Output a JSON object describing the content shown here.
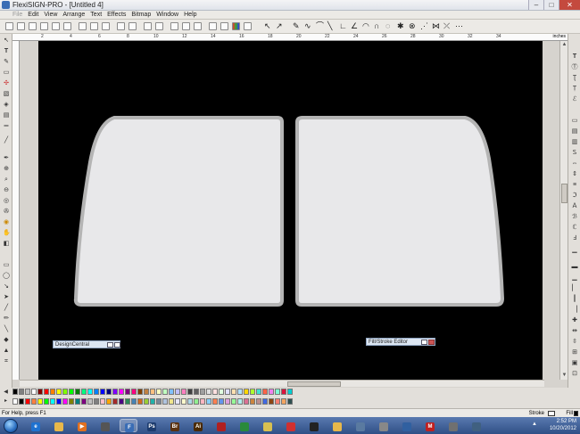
{
  "window": {
    "title": "FlexiSIGN-PRO - [Untitled 4]",
    "min": "–",
    "max": "□",
    "close": "✕"
  },
  "menu": [
    "File",
    "Edit",
    "View",
    "Arrange",
    "Text",
    "Effects",
    "Bitmap",
    "Window",
    "Help"
  ],
  "ruler": {
    "units": "inches",
    "labels": [
      "2",
      "4",
      "6",
      "8",
      "10",
      "12",
      "14",
      "16",
      "18",
      "20",
      "22",
      "24",
      "26",
      "28",
      "30",
      "32",
      "34"
    ]
  },
  "canvas": {
    "background": "#000000",
    "shape_fill": "#e8e8ea",
    "shape_stroke": "#b4b4b4"
  },
  "panels": {
    "design_central": "DesignCentral",
    "fill_stroke_editor": "Fill/Stroke Editor"
  },
  "palette_colors_row1": [
    "#000000",
    "#808080",
    "#c0c0c0",
    "#ffffff",
    "#800000",
    "#ff0000",
    "#ff8000",
    "#ffff00",
    "#80ff00",
    "#00ff00",
    "#008000",
    "#00ff80",
    "#00ffff",
    "#0080ff",
    "#0000ff",
    "#000080",
    "#8000ff",
    "#ff00ff",
    "#800080",
    "#ff0080",
    "#804000",
    "#c08040",
    "#ffc080",
    "#ffffc0",
    "#c0ffc0",
    "#80c0ff",
    "#c0c0ff",
    "#ff80c0",
    "#404040",
    "#606060",
    "#a0a0a0",
    "#e0e0e0",
    "#ffe0e0",
    "#e0ffe0",
    "#e0e0ff",
    "#ffe0b0",
    "#b0e0ff",
    "#ffd700",
    "#adff2f",
    "#40e0d0",
    "#ff6347",
    "#ee82ee",
    "#7fffd4",
    "#dc143c",
    "#00ced1"
  ],
  "palette_colors_row2": [
    "#ffffff",
    "#000000",
    "#ff0000",
    "#ff8040",
    "#ffff00",
    "#00ff00",
    "#00ffff",
    "#0000ff",
    "#ff00ff",
    "#808000",
    "#008080",
    "#800080",
    "#c0c0c0",
    "#808080",
    "#ffc0cb",
    "#ffa500",
    "#a52a2a",
    "#4b0082",
    "#2e8b57",
    "#4682b4",
    "#d2691e",
    "#9acd32",
    "#20b2aa",
    "#778899",
    "#b0c4de",
    "#f0e68c",
    "#e6e6fa",
    "#fffacd",
    "#add8e6",
    "#90ee90",
    "#ffb6c1",
    "#87cefa",
    "#ff7f50",
    "#6495ed",
    "#dda0dd",
    "#98fb98",
    "#afeeee",
    "#db7093",
    "#cd853f",
    "#bc8f8f",
    "#4169e1",
    "#8b4513",
    "#fa8072",
    "#f4a460",
    "#2f4f4f"
  ],
  "status": {
    "text": "For Help, press F1",
    "stroke": "Stroke",
    "fill": "Fill"
  },
  "taskbar": {
    "time": "2:52 PM",
    "date": "10/20/2012"
  },
  "taskbar_icons": [
    {
      "name": "ie-icon",
      "color": "#1e72d0",
      "letter": "e"
    },
    {
      "name": "explorer-icon",
      "color": "#e8b84a",
      "letter": ""
    },
    {
      "name": "media-icon",
      "color": "#e07020",
      "letter": "▶"
    },
    {
      "name": "drive-icon",
      "color": "#555",
      "letter": ""
    },
    {
      "name": "flexisign-icon",
      "color": "#3a6db5",
      "letter": "F",
      "active": true
    },
    {
      "name": "photoshop-icon",
      "color": "#1c3b6e",
      "letter": "Ps"
    },
    {
      "name": "bridge-icon",
      "color": "#5a3210",
      "letter": "Br"
    },
    {
      "name": "illustrator-icon",
      "color": "#4a2a00",
      "letter": "Ai"
    },
    {
      "name": "app-red-icon",
      "color": "#b02020",
      "letter": ""
    },
    {
      "name": "app-green-icon",
      "color": "#2a8a3a",
      "letter": ""
    },
    {
      "name": "app-paint-icon",
      "color": "#d8c050",
      "letter": ""
    },
    {
      "name": "app-circle-icon",
      "color": "#d03030",
      "letter": ""
    },
    {
      "name": "app-dark-icon",
      "color": "#222",
      "letter": ""
    },
    {
      "name": "app-folder-icon",
      "color": "#e8b84a",
      "letter": ""
    },
    {
      "name": "app-monitor-icon",
      "color": "#5a7aa0",
      "letter": ""
    },
    {
      "name": "app-scanner-icon",
      "color": "#888",
      "letter": ""
    },
    {
      "name": "app-globe-icon",
      "color": "#3060a0",
      "letter": ""
    },
    {
      "name": "mcafee-icon",
      "color": "#c02020",
      "letter": "M"
    },
    {
      "name": "app-tool-icon",
      "color": "#707070",
      "letter": ""
    },
    {
      "name": "app-net-icon",
      "color": "#406080",
      "letter": ""
    }
  ]
}
